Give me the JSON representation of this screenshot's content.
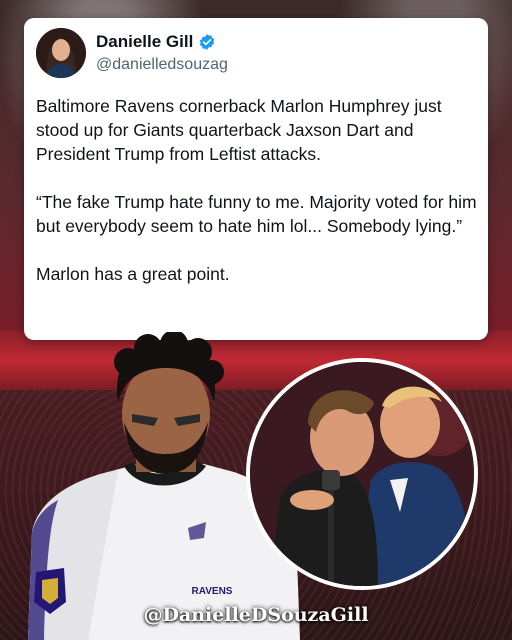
{
  "post": {
    "author_name": "Danielle Gill",
    "author_handle": "@danielledsouzag",
    "verified_icon": "verified-badge-icon",
    "paragraphs": [
      "Baltimore Ravens cornerback Marlon Humphrey just stood up for Giants quarterback Jaxson Dart and President Trump from Leftist attacks.",
      "“The fake Trump hate funny to me. Majority voted for him but everybody seem to hate him lol... Somebody lying.”",
      "Marlon has a great point."
    ]
  },
  "photo": {
    "jersey_text": "RAVENS"
  },
  "watermark": "@DanielleDSouzaGill",
  "colors": {
    "verified_blue": "#1d9bf0",
    "ravens_purple": "#241773",
    "stadium_red": "#c8283a"
  }
}
